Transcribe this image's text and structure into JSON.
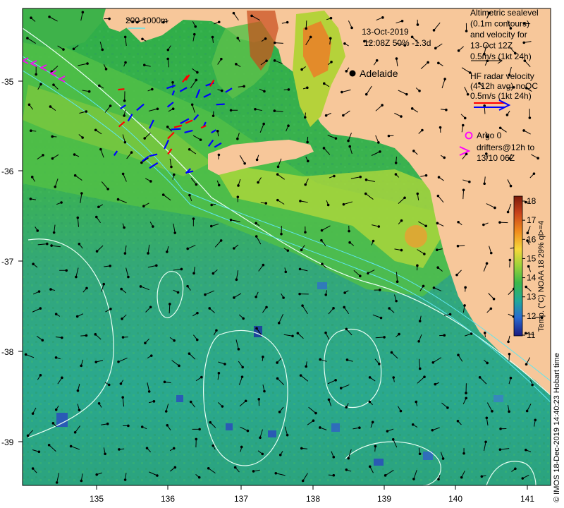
{
  "map": {
    "x_ticks": [
      "135",
      "136",
      "137",
      "138",
      "139",
      "140",
      "141"
    ],
    "y_ticks": [
      "-35",
      "-36",
      "-37",
      "-38",
      "-39"
    ],
    "scale_label": "200  1000m",
    "date_text": "13-Oct-2019",
    "time_text": "12:08Z  50% -1.3d",
    "city": "Adelaide",
    "legend_altimetric": [
      "Altimetric sealevel",
      "(0.1m contours)",
      "and velocity for",
      "13-Oct 12Z",
      "0.5m/s (1kt 24h)"
    ],
    "legend_hf": [
      "HF radar velocity",
      "(4-12h avg) noQC",
      "0.5m/s (1kt 24h)"
    ],
    "legend_argo": "Argo 0",
    "legend_drifters": [
      "drifters@12h to",
      "13/10 06Z"
    ],
    "colorbar_ticks": [
      "18",
      "17",
      "16",
      "15",
      "14",
      "13",
      "12",
      "11"
    ],
    "colorbar_label": "Temp. (°C) NOAA 18 29% ql>=4",
    "credit": "© IMOS 18-Dec-2019 14:40:23 Hobart time",
    "colors": {
      "land": "#f7c79a",
      "sea_green": "#3fb35a",
      "coastal_yellow": "#d8e84a",
      "argo": "#ff00ff",
      "hf_red": "#ff0000",
      "hf_blue": "#0000ff"
    }
  }
}
